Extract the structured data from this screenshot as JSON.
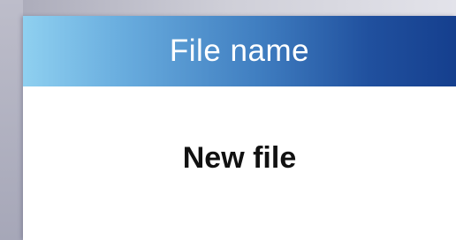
{
  "dialog": {
    "title": "File name",
    "value": "New file"
  }
}
